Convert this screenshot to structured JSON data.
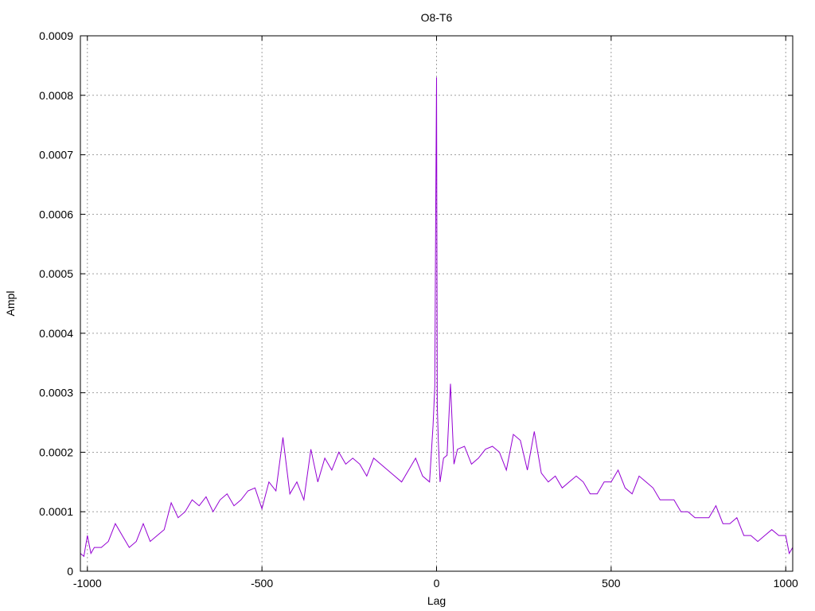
{
  "chart_data": {
    "type": "line",
    "title": "O8-T6",
    "xlabel": "Lag",
    "ylabel": "Ampl",
    "xlim": [
      -1020,
      1020
    ],
    "ylim": [
      0,
      0.0009
    ],
    "x_ticks": [
      -1000,
      -500,
      0,
      500,
      1000
    ],
    "x_tick_labels": [
      "-1000",
      "-500",
      "0",
      "500",
      "1000"
    ],
    "y_ticks": [
      0,
      0.0001,
      0.0002,
      0.0003,
      0.0004,
      0.0005,
      0.0006,
      0.0007,
      0.0008,
      0.0009
    ],
    "y_tick_labels": [
      "0",
      "0.0001",
      "0.0002",
      "0.0003",
      "0.0004",
      "0.0005",
      "0.0006",
      "0.0007",
      "0.0008",
      "0.0009"
    ],
    "grid": true,
    "series": [
      {
        "color": "#9400d3",
        "x": [
          -1020,
          -1010,
          -1000,
          -990,
          -980,
          -960,
          -940,
          -920,
          -900,
          -880,
          -860,
          -840,
          -820,
          -800,
          -780,
          -760,
          -740,
          -720,
          -700,
          -680,
          -660,
          -640,
          -620,
          -600,
          -580,
          -560,
          -540,
          -520,
          -500,
          -480,
          -460,
          -440,
          -420,
          -400,
          -380,
          -360,
          -340,
          -320,
          -300,
          -280,
          -260,
          -240,
          -220,
          -200,
          -180,
          -160,
          -140,
          -120,
          -100,
          -80,
          -60,
          -40,
          -20,
          -10,
          -5,
          -2,
          0,
          2,
          5,
          10,
          20,
          30,
          40,
          50,
          60,
          80,
          100,
          120,
          140,
          160,
          180,
          200,
          220,
          240,
          260,
          280,
          300,
          320,
          340,
          360,
          380,
          400,
          420,
          440,
          460,
          480,
          500,
          520,
          540,
          560,
          580,
          600,
          620,
          640,
          660,
          680,
          700,
          720,
          740,
          760,
          780,
          800,
          820,
          840,
          860,
          880,
          900,
          920,
          940,
          960,
          980,
          1000,
          1010,
          1020
        ],
        "y": [
          3e-05,
          2.5e-05,
          6e-05,
          3e-05,
          4e-05,
          4e-05,
          5e-05,
          8e-05,
          6e-05,
          4e-05,
          5e-05,
          8e-05,
          5e-05,
          6e-05,
          7e-05,
          0.000115,
          9e-05,
          0.0001,
          0.00012,
          0.00011,
          0.000125,
          0.0001,
          0.00012,
          0.00013,
          0.00011,
          0.00012,
          0.000135,
          0.00014,
          0.000105,
          0.00015,
          0.000135,
          0.000225,
          0.00013,
          0.00015,
          0.00012,
          0.000205,
          0.00015,
          0.00019,
          0.00017,
          0.0002,
          0.00018,
          0.00019,
          0.00018,
          0.00016,
          0.00019,
          0.00018,
          0.00017,
          0.00016,
          0.00015,
          0.00017,
          0.00019,
          0.00016,
          0.00015,
          0.000245,
          0.00031,
          0.00064,
          0.00083,
          0.00028,
          0.00022,
          0.00015,
          0.00019,
          0.000195,
          0.000315,
          0.00018,
          0.000205,
          0.00021,
          0.00018,
          0.00019,
          0.000205,
          0.00021,
          0.0002,
          0.00017,
          0.00023,
          0.00022,
          0.00017,
          0.000235,
          0.000165,
          0.00015,
          0.00016,
          0.00014,
          0.00015,
          0.00016,
          0.00015,
          0.00013,
          0.00013,
          0.00015,
          0.00015,
          0.00017,
          0.00014,
          0.00013,
          0.00016,
          0.00015,
          0.00014,
          0.00012,
          0.00012,
          0.00012,
          0.0001,
          0.0001,
          9e-05,
          9e-05,
          9e-05,
          0.00011,
          8e-05,
          8e-05,
          9e-05,
          6e-05,
          6e-05,
          5e-05,
          6e-05,
          7e-05,
          6e-05,
          6e-05,
          3e-05,
          4e-05
        ]
      }
    ]
  }
}
